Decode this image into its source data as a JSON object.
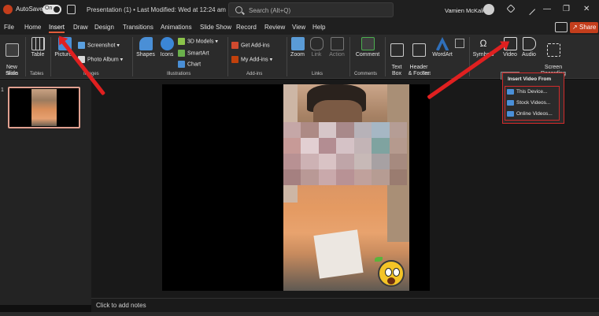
{
  "titlebar": {
    "autosave_label": "AutoSave",
    "toggle_state": "On",
    "doc_title": "Presentation (1) • Last Modified: Wed at 12:24 am",
    "search_placeholder": "Search (Alt+Q)",
    "user_name": "Vamien McKalin"
  },
  "tabs": [
    "File",
    "Home",
    "Insert",
    "Draw",
    "Design",
    "Transitions",
    "Animations",
    "Slide Show",
    "Record",
    "Review",
    "View",
    "Help"
  ],
  "active_tab": "Insert",
  "share_label": "Share",
  "ribbon": {
    "new_slide": "New\nSlide",
    "table": "Table",
    "pictures": "Pictures",
    "screenshot": "Screenshot",
    "photo_album": "Photo Album",
    "shapes": "Shapes",
    "icons": "Icons",
    "models_3d": "3D Models",
    "smartart": "SmartArt",
    "chart": "Chart",
    "get_addins": "Get Add-ins",
    "my_addins": "My Add-ins",
    "zoom": "Zoom",
    "link": "Link",
    "action": "Action",
    "comment": "Comment",
    "text_box": "Text\nBox",
    "header_footer": "Header\n& Footer",
    "wordart": "WordArt",
    "symbols": "Symbols",
    "video": "Video",
    "audio": "Audio",
    "screen_recording": "Screen\nRecording",
    "groups": {
      "slides": "Slides",
      "tables": "Tables",
      "images": "Images",
      "illustrations": "Illustrations",
      "addins": "Add-ins",
      "links": "Links",
      "comments": "Comments",
      "text": "Text"
    }
  },
  "video_dropdown": {
    "header": "Insert Video From",
    "items": [
      "This Device...",
      "Stock Videos...",
      "Online Videos..."
    ]
  },
  "slides_panel": {
    "slide_number": "1"
  },
  "notes_placeholder": "Click to add notes",
  "colors": {
    "accent": "#c43e1c",
    "annotation_red": "#e02020",
    "ribbon_bg": "#2b2b2b"
  }
}
